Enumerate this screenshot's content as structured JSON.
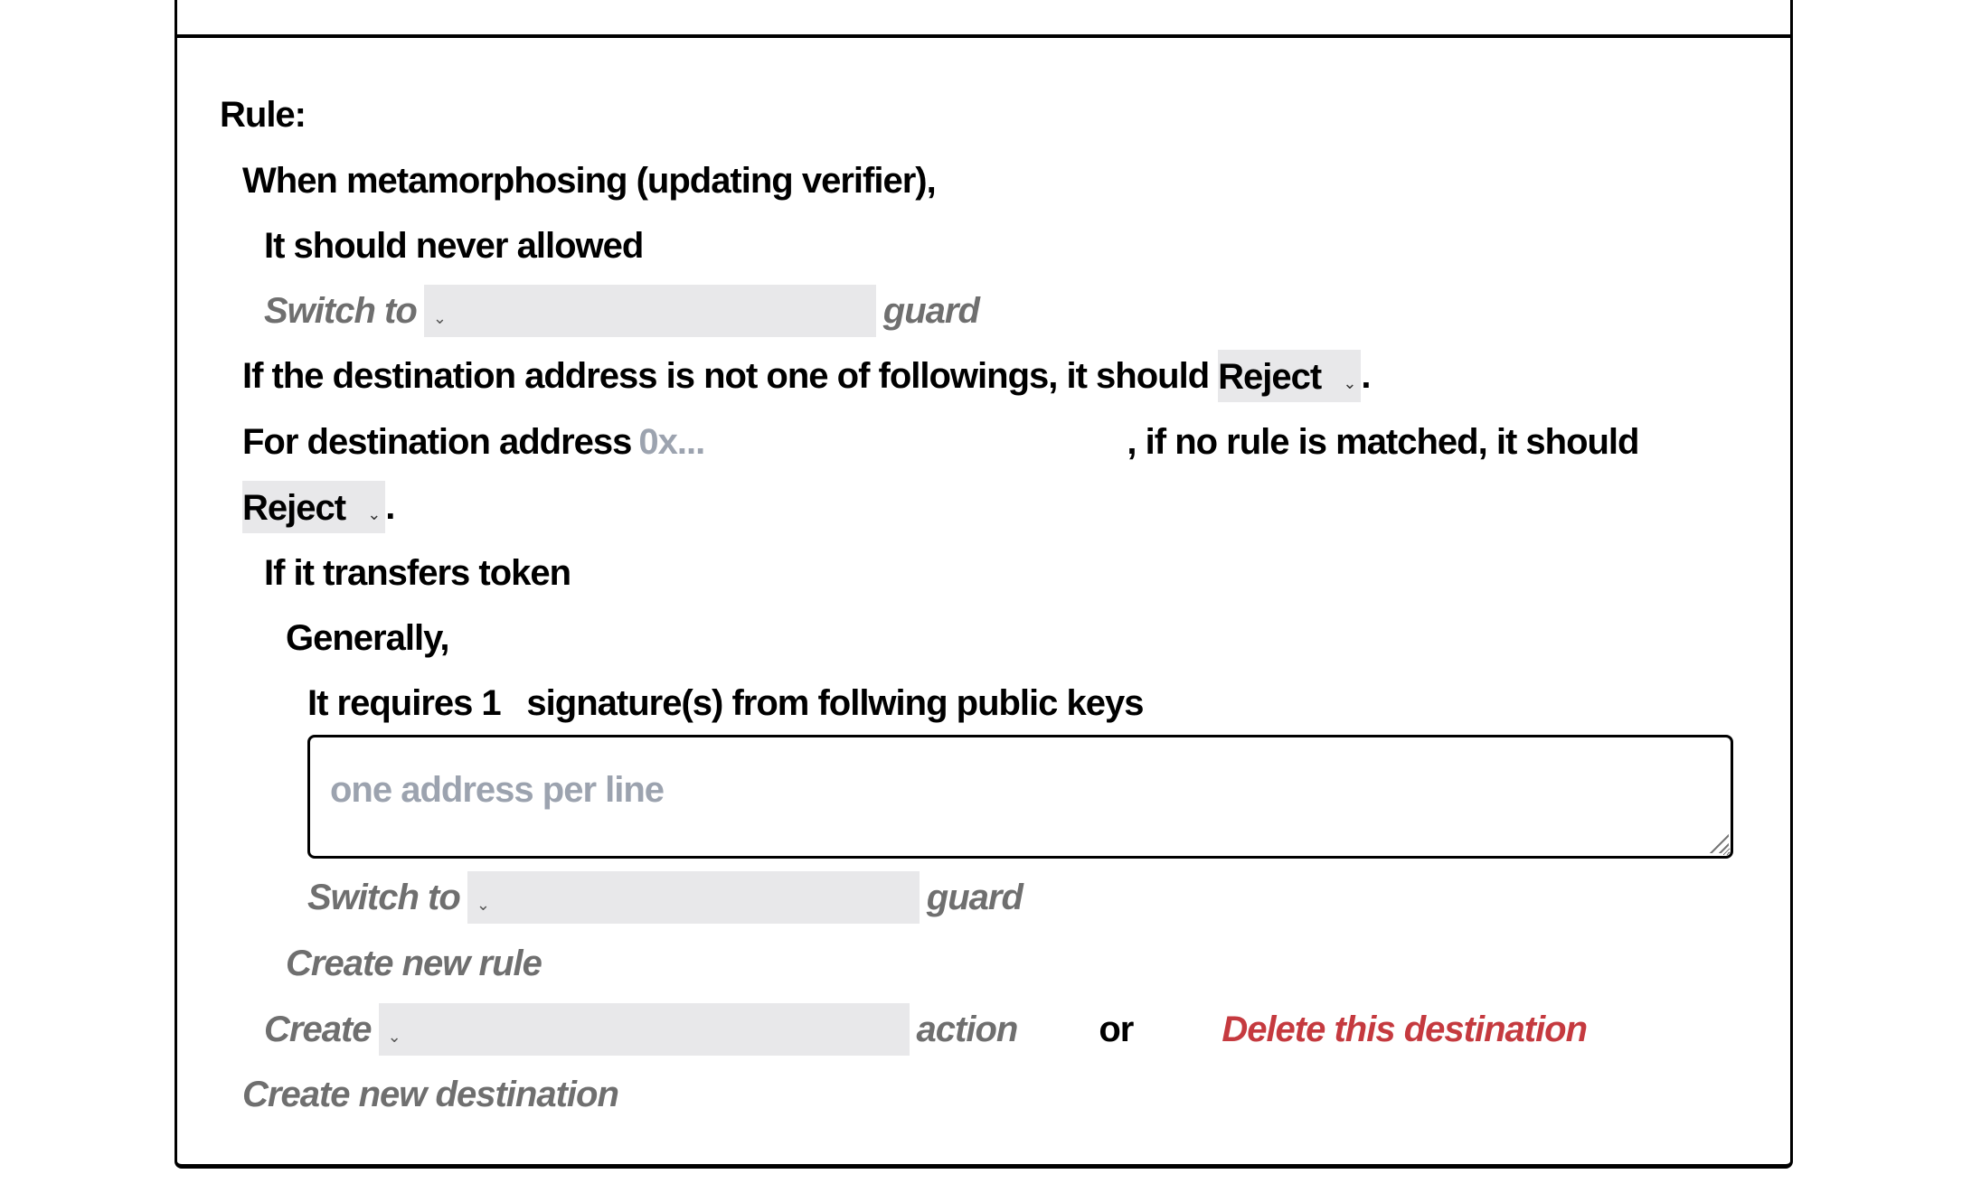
{
  "rule": {
    "heading": "Rule:",
    "metamorphosing": {
      "label": "When metamorphosing (updating verifier),",
      "policy_text": "It should never allowed",
      "switch": {
        "prefix": "Switch to",
        "selected": "",
        "suffix": "guard"
      }
    },
    "destination_default": {
      "prefix": "If the destination address is not one of followings, it should",
      "selected": "Reject",
      "suffix": "."
    },
    "destination": {
      "prefix": "For destination address",
      "address_value": "",
      "address_placeholder": "0x...",
      "middle": ", if no rule is matched, it should",
      "selected": "Reject",
      "suffix": ".",
      "transfer": {
        "label": "If it transfers token",
        "general_label": "Generally,",
        "requires_prefix": "It requires",
        "required_count": "1",
        "requires_suffix": "signature(s) from follwing public keys",
        "keys_value": "",
        "keys_placeholder": "one address per line",
        "switch": {
          "prefix": "Switch to",
          "selected": "",
          "suffix": "guard"
        },
        "create_rule_label": "Create new rule"
      },
      "create_action": {
        "prefix": "Create",
        "selected": "",
        "suffix": "action"
      },
      "or_label": "or",
      "delete_label": "Delete this destination"
    },
    "create_destination_label": "Create new destination"
  },
  "icons": {
    "select_chevron": "chevron-down-icon",
    "resize": "resize-grip-icon"
  },
  "colors": {
    "muted": "#6f6f6f",
    "danger": "#c53a3f",
    "placeholder": "#9ca3af",
    "select_bg": "#e8e8ea"
  }
}
